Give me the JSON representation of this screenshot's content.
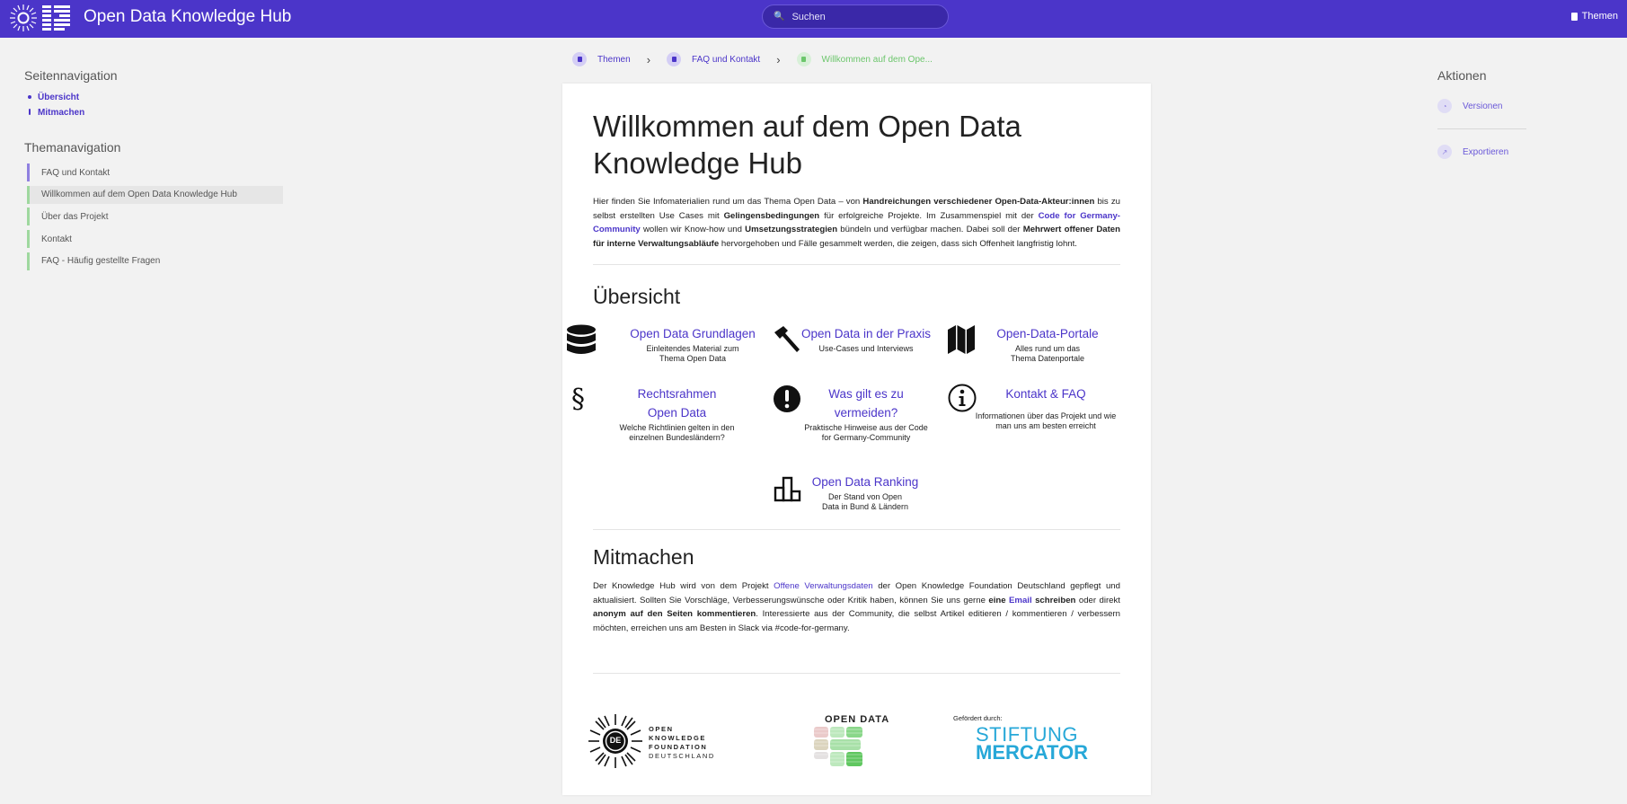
{
  "header": {
    "app_title": "Open Data Knowledge Hub",
    "search_placeholder": "Suchen",
    "themen_label": "Themen"
  },
  "left_sidebar": {
    "page_nav_heading": "Seitennavigation",
    "page_nav_items": [
      "Übersicht",
      "Mitmachen"
    ],
    "theme_nav_heading": "Themanavigation",
    "theme_nav_items": [
      "FAQ und Kontakt",
      "Willkommen auf dem Open Data Knowledge Hub",
      "Über das Projekt",
      "Kontakt",
      "FAQ - Häufig gestellte Fragen"
    ]
  },
  "breadcrumb": [
    "Themen",
    "FAQ und Kontakt",
    "Willkommen auf dem Ope..."
  ],
  "right_sidebar": {
    "heading": "Aktionen",
    "items": [
      "Versionen",
      "Exportieren"
    ]
  },
  "main": {
    "title": "Willkommen auf dem Open Data Knowledge Hub",
    "intro": {
      "p1": "Hier finden Sie Infomaterialien rund um das Thema Open Data – von ",
      "b1": "Handreichungen verschiedener Open-Data-Akteur:innen",
      "p2": " bis zu selbst erstellten Use Cases mit ",
      "b2": "Gelingensbedingungen",
      "p3": " für erfolgreiche Projekte. Im Zusammenspiel mit der ",
      "link": "Code for Germany-Community",
      "p4": " wollen wir Know-how und ",
      "b3": "Umsetzungsstrategien",
      "p5": " bündeln und verfügbar machen. Dabei soll der ",
      "b4": "Mehrwert offener Daten für interne Verwaltungsabläufe",
      "p6": " hervorgehoben und Fälle gesammelt werden, die zeigen, dass sich Offenheit langfristig lohnt."
    },
    "overview_heading": "Übersicht",
    "tiles": [
      {
        "title": "Open Data Grundlagen",
        "desc": "Einleitendes Material zum Thema Open Data",
        "icon": "database-icon"
      },
      {
        "title": "Open Data in der Praxis",
        "desc": "Use-Cases und Interviews",
        "icon": "hammer-icon"
      },
      {
        "title": "Open-Data-Portale",
        "desc": "Alles rund um das Thema Datenportale",
        "icon": "map-icon"
      },
      {
        "title": "Rechtsrahmen Open Data",
        "desc": "Welche Richtlinien gelten in den einzelnen Bundesländern?",
        "icon": "paragraph-icon"
      },
      {
        "title": "Was gilt es zu vermeiden?",
        "desc": "Praktische Hinweise aus der Code for Germany-Community",
        "icon": "exclamation-icon"
      },
      {
        "title": "Kontakt & FAQ",
        "desc": "Informationen über das Projekt und wie man uns am besten erreicht",
        "icon": "info-icon"
      },
      {
        "title": "Open Data Ranking",
        "desc": "Der Stand von Open Data in Bund & Ländern",
        "icon": "podium-icon"
      }
    ],
    "mitmachen_heading": "Mitmachen",
    "mitmachen": {
      "p1": "Der Knowledge Hub wird von dem Projekt ",
      "link1": "Offene Verwaltungsdaten",
      "p2": " der Open Knowledge Foundation Deutschland gepflegt und aktualisiert. Sollten Sie Vorschläge, Verbesserungswünsche oder Kritik haben, können Sie uns gerne ",
      "b1": "eine ",
      "link2": "Email",
      "b2": " schreiben",
      "p3": " oder direkt ",
      "b3": "anonym auf den Seiten kommentieren",
      "p4": ". Interessierte aus der Community, die selbst Artikel editieren / kommentieren / verbessern möchten, erreichen uns am Besten in Slack via #code-for-germany."
    },
    "footer": {
      "okf_lines": [
        "OPEN",
        "KNOWLEDGE",
        "FOUNDATION",
        "DEUTSCHLAND"
      ],
      "okf_badge": "DE",
      "opendata_label": "OPEN DATA",
      "gefoerdert": "Gefördert durch:",
      "stiftung_line1": "STIFTUNG",
      "stiftung_line2": "MERCATOR"
    }
  },
  "colors": {
    "header_bg": "#4b35c9",
    "link": "#4b35c9",
    "green_accent": "#6cc66c",
    "stiftung_blue": "#27a8d8"
  }
}
